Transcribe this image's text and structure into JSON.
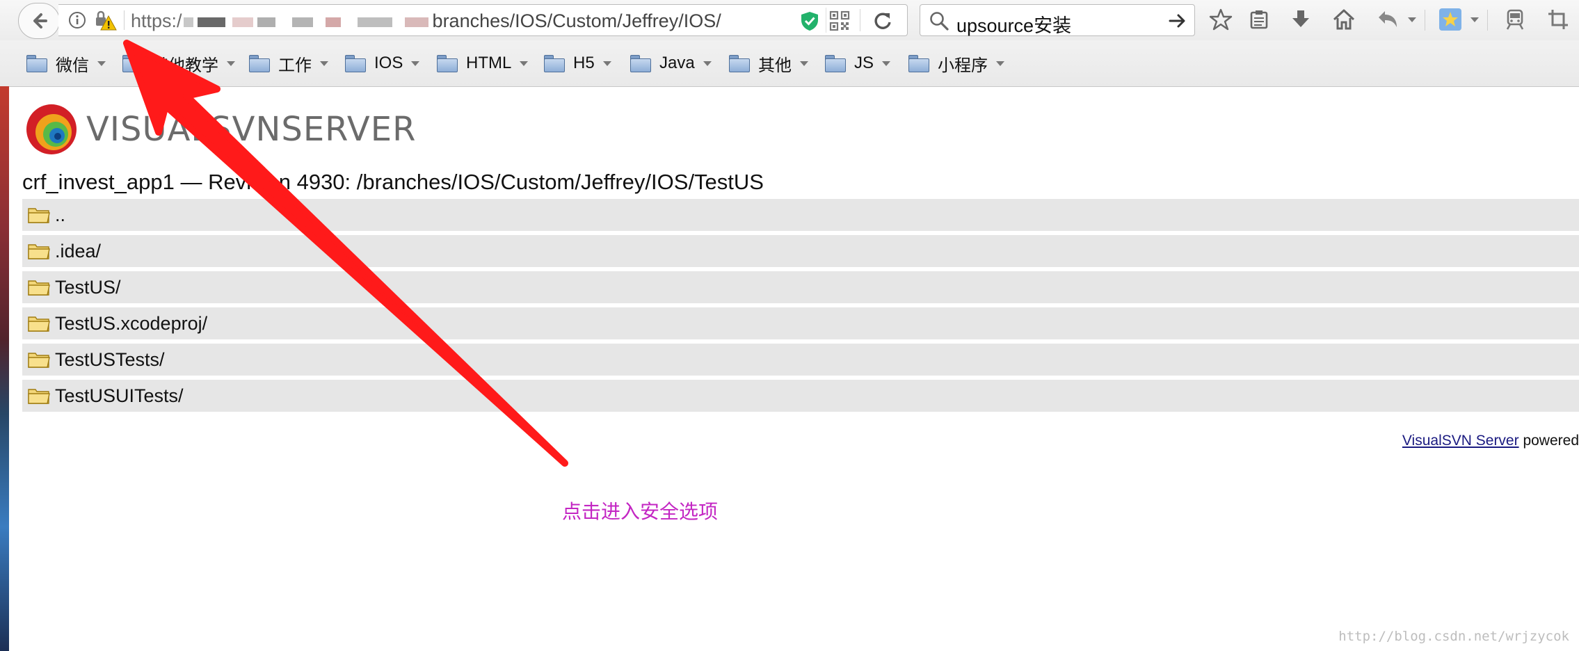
{
  "browser": {
    "url_prefix": "https:/",
    "url_path": "branches/IOS/Custom/Jeffrey/IOS/",
    "search_query": "upsource安装"
  },
  "bookmarks": [
    {
      "label": "微信"
    },
    {
      "label": "其他教学"
    },
    {
      "label": "工作"
    },
    {
      "label": "IOS"
    },
    {
      "label": "HTML"
    },
    {
      "label": "H5"
    },
    {
      "label": "Java"
    },
    {
      "label": "其他"
    },
    {
      "label": "JS"
    },
    {
      "label": "小程序"
    }
  ],
  "page": {
    "logo_text": "VISUALSVNSERVER",
    "repo_title": "crf_invest_app1 — Revision 4930: /branches/IOS/Custom/Jeffrey/IOS/TestUS",
    "entries": [
      {
        "name": ".."
      },
      {
        "name": ".idea/"
      },
      {
        "name": "TestUS/"
      },
      {
        "name": "TestUS.xcodeproj/"
      },
      {
        "name": "TestUSTests/"
      },
      {
        "name": "TestUSUITests/"
      }
    ],
    "footer_link": "VisualSVN Server",
    "footer_suffix": " powered"
  },
  "annotation": {
    "text": "点击进入安全选项",
    "color": "#c326c3",
    "arrow_color": "#ff1a1a"
  },
  "watermark": "http://blog.csdn.net/wrjzycok",
  "icons": [
    "back-arrow-icon",
    "info-icon",
    "lock-warning-icon",
    "shield-icon",
    "qrcode-icon",
    "reload-icon",
    "search-icon",
    "go-arrow-icon",
    "star-icon",
    "clipboard-icon",
    "download-icon",
    "home-icon",
    "undo-icon",
    "extension-icon",
    "train-icon",
    "crop-icon",
    "folder-icon"
  ]
}
